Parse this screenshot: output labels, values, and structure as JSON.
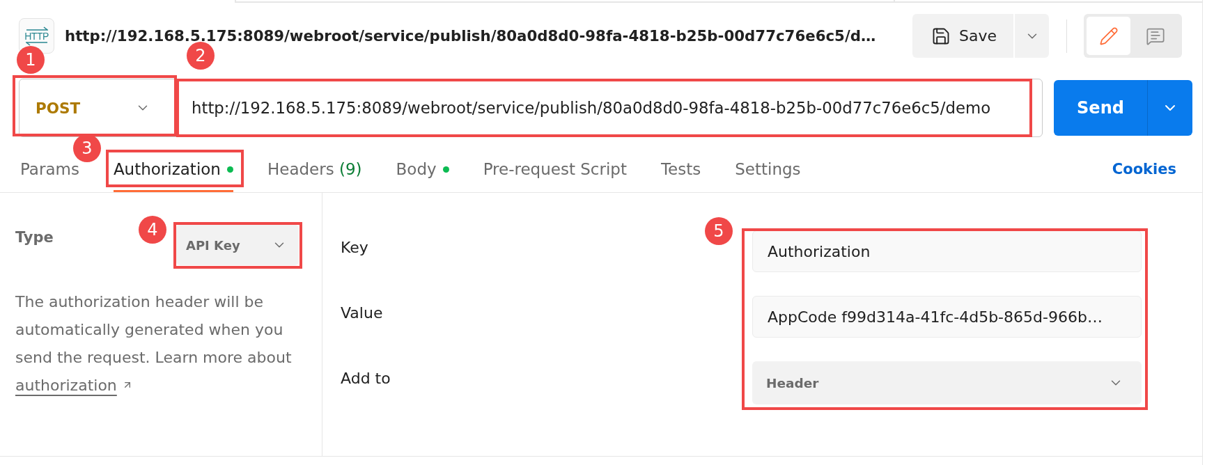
{
  "header": {
    "protocol_label": "HTTP",
    "title": "http://192.168.5.175:8089/webroot/service/publish/80a0d8d0-98fa-4818-b25b-00d77c76e6c5/d…",
    "save_button": "Save",
    "mode_toggle": [
      {
        "kind": "edit",
        "selected": true
      },
      {
        "kind": "comments",
        "selected": false
      }
    ]
  },
  "request": {
    "method": {
      "value": "POST",
      "annotation": "1"
    },
    "url": {
      "value": "http://192.168.5.175:8089/webroot/service/publish/80a0d8d0-98fa-4818-b25b-00d77c76e6c5/demo",
      "annotation": "2"
    },
    "send_button": "Send"
  },
  "tabs": [
    {
      "label": "Params",
      "dot": false,
      "selected": false
    },
    {
      "label": "Authorization",
      "dot": true,
      "selected": true,
      "annotation": "3"
    },
    {
      "label": "Headers",
      "count": "(9)",
      "dot": false,
      "selected": false
    },
    {
      "label": "Body",
      "dot": true,
      "selected": false
    },
    {
      "label": "Pre-request Script",
      "dot": false,
      "selected": false
    },
    {
      "label": "Tests",
      "dot": false,
      "selected": false
    },
    {
      "label": "Settings",
      "dot": false,
      "selected": false
    }
  ],
  "cookies_link": "Cookies",
  "auth": {
    "type_label": "Type",
    "type_select": {
      "value": "API Key",
      "annotation": "4"
    },
    "description": "The authorization header will be automatically generated when you send the request. Learn more about",
    "link": "authorization",
    "fields_annotation": "5",
    "fields": [
      {
        "label": "Key",
        "kind": "input",
        "value": "Authorization"
      },
      {
        "label": "Value",
        "kind": "input",
        "value": "AppCode f99d314a-41fc-4d5b-865d-966b…"
      },
      {
        "label": "Add to",
        "kind": "select",
        "value": "Header"
      }
    ]
  }
}
